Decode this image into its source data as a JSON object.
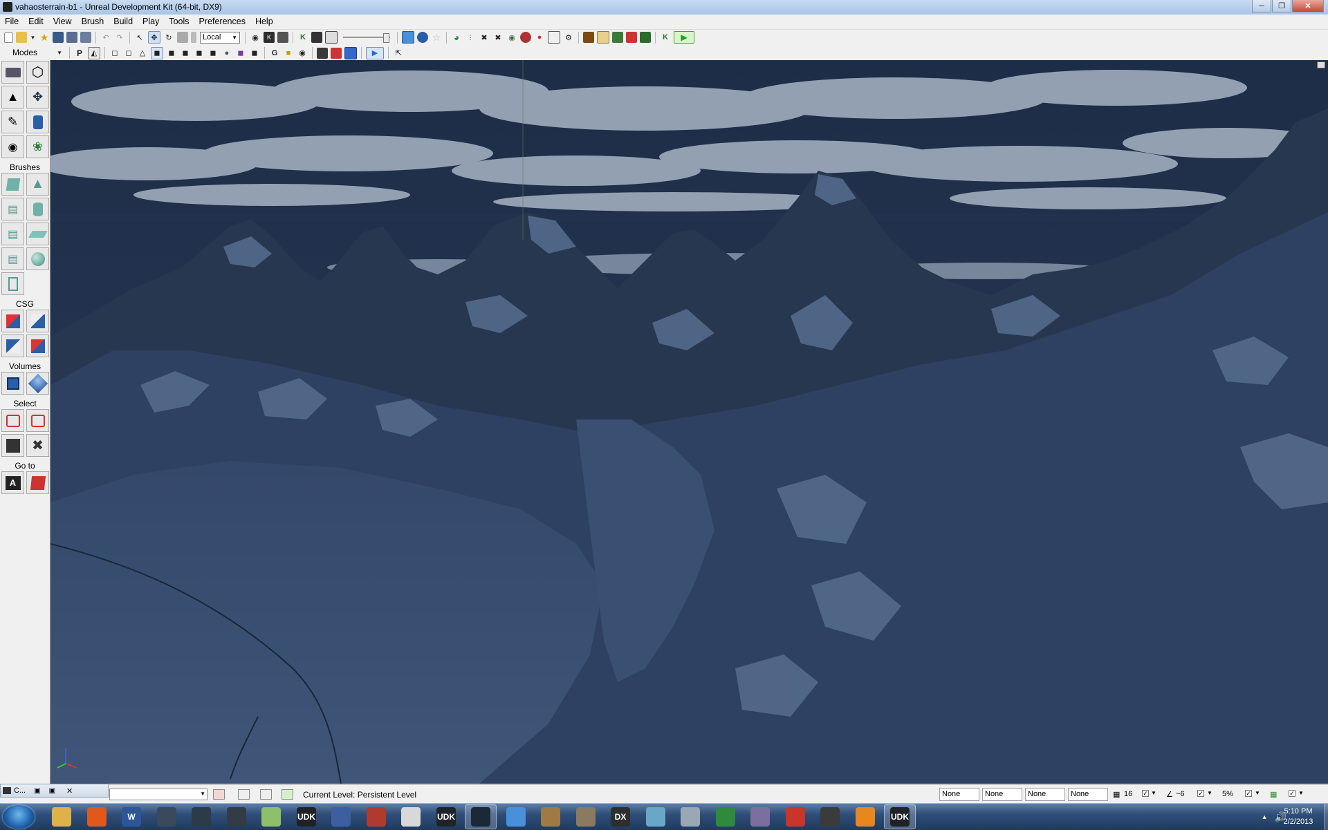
{
  "window": {
    "title": "vahaosterrain-b1 - Unreal Development Kit (64-bit, DX9)",
    "controls": [
      "minimize",
      "maximize",
      "close"
    ]
  },
  "menu": [
    "File",
    "Edit",
    "View",
    "Brush",
    "Build",
    "Play",
    "Tools",
    "Preferences",
    "Help"
  ],
  "toolbar1": {
    "coordinate_system": "Local",
    "icons": [
      "new-icon",
      "open-icon",
      "open-dropdown-icon",
      "favorites-icon",
      "save-icon",
      "save-all-icon",
      "save-as-icon",
      "undo-icon",
      "redo-icon",
      "select-icon",
      "translate-icon",
      "rotate-icon",
      "scale-icon",
      "scale-nonuniform-icon",
      "find-icon",
      "kismet-icon",
      "content-browser-icon",
      "build-geometry-icon",
      "build-lighting-icon",
      "build-paths-icon",
      "build-cover-icon",
      "build-all-icon",
      "play-in-editor-icon"
    ]
  },
  "toolbar2": {
    "icons": [
      "viewport-options-icon",
      "perspective-icon",
      "wireframe-icon",
      "brush-wireframe-icon",
      "unlit-icon",
      "lit-icon",
      "detail-lighting-icon",
      "lighting-only-icon",
      "light-complexity-icon",
      "texture-density-icon",
      "shader-complexity-icon",
      "lightmap-density-icon",
      "game-view-icon",
      "lock-icon",
      "show-flags-icon",
      "kismet-flag-icon",
      "cinematic-icon",
      "realtime-icon",
      "play-preview-icon",
      "detach-icon"
    ]
  },
  "modes_panel": {
    "title": "Modes",
    "sections": [
      {
        "label": "",
        "tools": [
          "camera-mode-icon",
          "geometry-mode-icon",
          "terrain-mode-icon",
          "landscape-mode-icon",
          "texture-align-icon",
          "mesh-paint-icon",
          "static-mesh-icon",
          "foliage-mode-icon"
        ]
      },
      {
        "label": "Brushes",
        "tools": [
          "cube-brush-icon",
          "cone-brush-icon",
          "curved-stair-icon",
          "cylinder-brush-icon",
          "linear-stair-icon",
          "sheet-brush-icon",
          "spiral-stair-icon",
          "sphere-brush-icon",
          "volumetric-brush-icon"
        ]
      },
      {
        "label": "CSG",
        "tools": [
          "csg-add-icon",
          "csg-subtract-icon",
          "csg-intersect-icon",
          "csg-deintersect-icon"
        ]
      },
      {
        "label": "Volumes",
        "tools": [
          "add-volume-icon",
          "volume-list-icon"
        ]
      },
      {
        "label": "Select",
        "tools": [
          "show-selected-icon",
          "hide-selected-icon",
          "select-invert-icon",
          "show-all-icon"
        ]
      },
      {
        "label": "Go to",
        "tools": [
          "goto-actor-icon",
          "goto-builder-brush-icon"
        ]
      }
    ]
  },
  "statusbar": {
    "floating_window_label": "C...",
    "current_level_label": "Current Level:",
    "current_level_value": "Persistent Level",
    "snap_fields": [
      "None",
      "None",
      "None",
      "None"
    ],
    "grid_size": "16",
    "rotation_snap": "~6",
    "scale_snap": "5%"
  },
  "taskbar": {
    "apps": [
      {
        "name": "explorer",
        "label": "",
        "color": "#e0b04a"
      },
      {
        "name": "firefox",
        "label": "",
        "color": "#e2581c"
      },
      {
        "name": "word",
        "label": "W",
        "color": "#2b5797"
      },
      {
        "name": "app-4",
        "label": "",
        "color": "#3a4a5c"
      },
      {
        "name": "app-5",
        "label": "",
        "color": "#2d3a48"
      },
      {
        "name": "app-6",
        "label": "",
        "color": "#333b44"
      },
      {
        "name": "app-7",
        "label": "",
        "color": "#8fbf6a"
      },
      {
        "name": "udk-1",
        "label": "UDK",
        "color": "#1f2328"
      },
      {
        "name": "app-9",
        "label": "",
        "color": "#3d5fa0"
      },
      {
        "name": "app-10",
        "label": "",
        "color": "#b03a2e"
      },
      {
        "name": "app-11",
        "label": "",
        "color": "#d8d8d8"
      },
      {
        "name": "udk-2",
        "label": "UDK",
        "color": "#1f2328"
      },
      {
        "name": "steam",
        "label": "",
        "color": "#1b2838"
      },
      {
        "name": "chrome",
        "label": "",
        "color": "#4a90d9"
      },
      {
        "name": "app-15",
        "label": "",
        "color": "#a07a44"
      },
      {
        "name": "gimp",
        "label": "",
        "color": "#8a7a60"
      },
      {
        "name": "directx",
        "label": "DX",
        "color": "#2e2e2e"
      },
      {
        "name": "app-18",
        "label": "",
        "color": "#6aa6c8"
      },
      {
        "name": "calculator",
        "label": "",
        "color": "#9aa7b5"
      },
      {
        "name": "app-20",
        "label": "",
        "color": "#2f8a3c"
      },
      {
        "name": "app-21",
        "label": "",
        "color": "#7b6fa0"
      },
      {
        "name": "sketchup",
        "label": "",
        "color": "#c8352a"
      },
      {
        "name": "unity",
        "label": "",
        "color": "#3b3b3b"
      },
      {
        "name": "media-player",
        "label": "",
        "color": "#e8871e"
      },
      {
        "name": "udk-3",
        "label": "UDK",
        "color": "#1f2328"
      }
    ],
    "active_apps": [
      "steam",
      "udk-3"
    ],
    "clock_time": "5:10 PM",
    "clock_date": "2/2/2013"
  }
}
